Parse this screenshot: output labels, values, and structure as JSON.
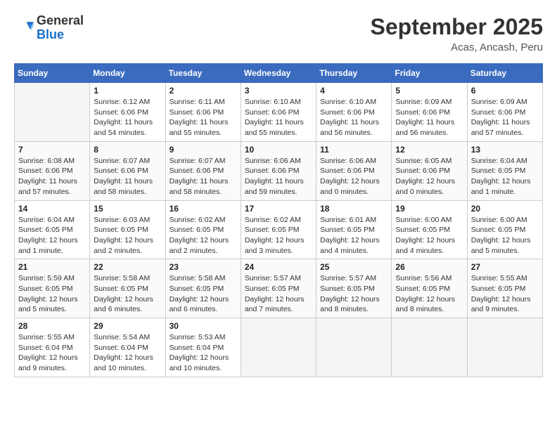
{
  "logo": {
    "general": "General",
    "blue": "Blue"
  },
  "header": {
    "title": "September 2025",
    "location": "Acas, Ancash, Peru"
  },
  "days_of_week": [
    "Sunday",
    "Monday",
    "Tuesday",
    "Wednesday",
    "Thursday",
    "Friday",
    "Saturday"
  ],
  "weeks": [
    [
      {
        "day": "",
        "empty": true
      },
      {
        "day": "1",
        "sunrise": "6:12 AM",
        "sunset": "6:06 PM",
        "daylight": "11 hours and 54 minutes."
      },
      {
        "day": "2",
        "sunrise": "6:11 AM",
        "sunset": "6:06 PM",
        "daylight": "11 hours and 55 minutes."
      },
      {
        "day": "3",
        "sunrise": "6:10 AM",
        "sunset": "6:06 PM",
        "daylight": "11 hours and 55 minutes."
      },
      {
        "day": "4",
        "sunrise": "6:10 AM",
        "sunset": "6:06 PM",
        "daylight": "11 hours and 56 minutes."
      },
      {
        "day": "5",
        "sunrise": "6:09 AM",
        "sunset": "6:06 PM",
        "daylight": "11 hours and 56 minutes."
      },
      {
        "day": "6",
        "sunrise": "6:09 AM",
        "sunset": "6:06 PM",
        "daylight": "11 hours and 57 minutes."
      }
    ],
    [
      {
        "day": "7",
        "sunrise": "6:08 AM",
        "sunset": "6:06 PM",
        "daylight": "11 hours and 57 minutes."
      },
      {
        "day": "8",
        "sunrise": "6:07 AM",
        "sunset": "6:06 PM",
        "daylight": "11 hours and 58 minutes."
      },
      {
        "day": "9",
        "sunrise": "6:07 AM",
        "sunset": "6:06 PM",
        "daylight": "11 hours and 58 minutes."
      },
      {
        "day": "10",
        "sunrise": "6:06 AM",
        "sunset": "6:06 PM",
        "daylight": "11 hours and 59 minutes."
      },
      {
        "day": "11",
        "sunrise": "6:06 AM",
        "sunset": "6:06 PM",
        "daylight": "12 hours and 0 minutes."
      },
      {
        "day": "12",
        "sunrise": "6:05 AM",
        "sunset": "6:06 PM",
        "daylight": "12 hours and 0 minutes."
      },
      {
        "day": "13",
        "sunrise": "6:04 AM",
        "sunset": "6:05 PM",
        "daylight": "12 hours and 1 minute."
      }
    ],
    [
      {
        "day": "14",
        "sunrise": "6:04 AM",
        "sunset": "6:05 PM",
        "daylight": "12 hours and 1 minute."
      },
      {
        "day": "15",
        "sunrise": "6:03 AM",
        "sunset": "6:05 PM",
        "daylight": "12 hours and 2 minutes."
      },
      {
        "day": "16",
        "sunrise": "6:02 AM",
        "sunset": "6:05 PM",
        "daylight": "12 hours and 2 minutes."
      },
      {
        "day": "17",
        "sunrise": "6:02 AM",
        "sunset": "6:05 PM",
        "daylight": "12 hours and 3 minutes."
      },
      {
        "day": "18",
        "sunrise": "6:01 AM",
        "sunset": "6:05 PM",
        "daylight": "12 hours and 4 minutes."
      },
      {
        "day": "19",
        "sunrise": "6:00 AM",
        "sunset": "6:05 PM",
        "daylight": "12 hours and 4 minutes."
      },
      {
        "day": "20",
        "sunrise": "6:00 AM",
        "sunset": "6:05 PM",
        "daylight": "12 hours and 5 minutes."
      }
    ],
    [
      {
        "day": "21",
        "sunrise": "5:59 AM",
        "sunset": "6:05 PM",
        "daylight": "12 hours and 5 minutes."
      },
      {
        "day": "22",
        "sunrise": "5:58 AM",
        "sunset": "6:05 PM",
        "daylight": "12 hours and 6 minutes."
      },
      {
        "day": "23",
        "sunrise": "5:58 AM",
        "sunset": "6:05 PM",
        "daylight": "12 hours and 6 minutes."
      },
      {
        "day": "24",
        "sunrise": "5:57 AM",
        "sunset": "6:05 PM",
        "daylight": "12 hours and 7 minutes."
      },
      {
        "day": "25",
        "sunrise": "5:57 AM",
        "sunset": "6:05 PM",
        "daylight": "12 hours and 8 minutes."
      },
      {
        "day": "26",
        "sunrise": "5:56 AM",
        "sunset": "6:05 PM",
        "daylight": "12 hours and 8 minutes."
      },
      {
        "day": "27",
        "sunrise": "5:55 AM",
        "sunset": "6:05 PM",
        "daylight": "12 hours and 9 minutes."
      }
    ],
    [
      {
        "day": "28",
        "sunrise": "5:55 AM",
        "sunset": "6:04 PM",
        "daylight": "12 hours and 9 minutes."
      },
      {
        "day": "29",
        "sunrise": "5:54 AM",
        "sunset": "6:04 PM",
        "daylight": "12 hours and 10 minutes."
      },
      {
        "day": "30",
        "sunrise": "5:53 AM",
        "sunset": "6:04 PM",
        "daylight": "12 hours and 10 minutes."
      },
      {
        "day": "",
        "empty": true
      },
      {
        "day": "",
        "empty": true
      },
      {
        "day": "",
        "empty": true
      },
      {
        "day": "",
        "empty": true
      }
    ]
  ]
}
